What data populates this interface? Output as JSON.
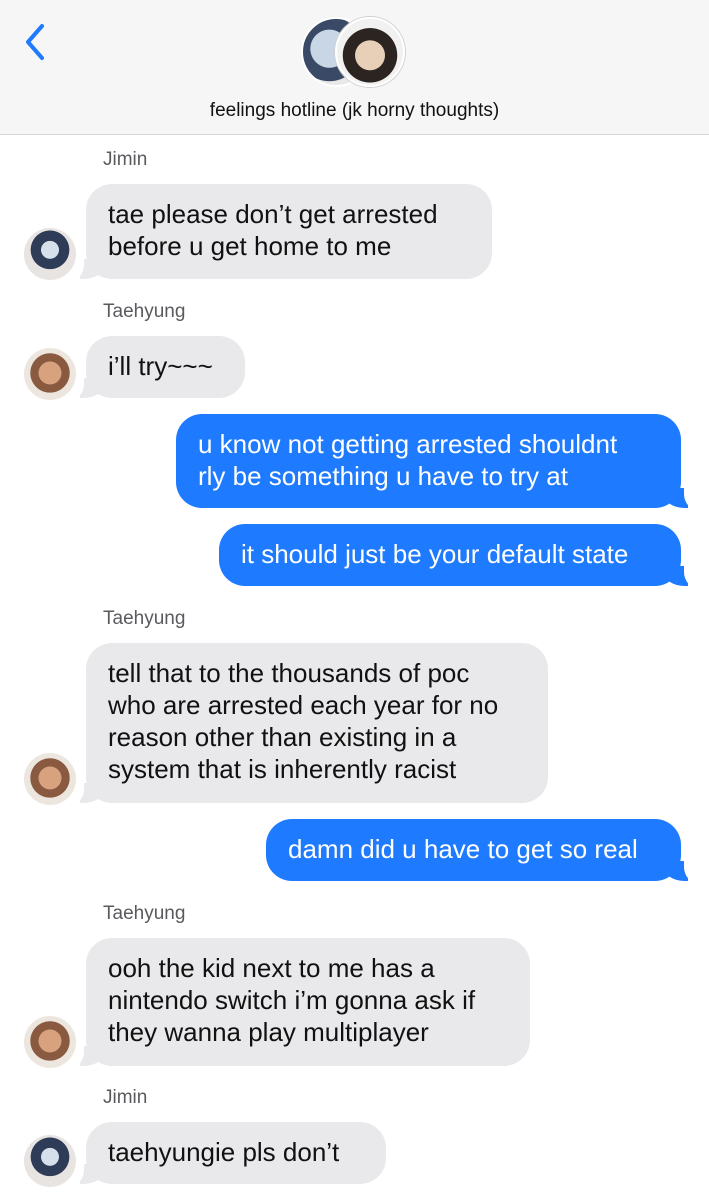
{
  "header": {
    "back_icon": "chevron-left-icon",
    "accent_color": "#1e7bff",
    "title": "feelings hotline (jk horny thoughts)"
  },
  "messages": [
    {
      "sender": "Jimin",
      "direction": "incoming",
      "lines": [
        "tae please don’t get arrested",
        "before u get home to me"
      ]
    },
    {
      "sender": "Taehyung",
      "direction": "incoming",
      "lines": [
        "i’ll try~~~"
      ]
    },
    {
      "sender": "",
      "direction": "outgoing",
      "lines": [
        "u know not getting arrested shouldnt",
        "rly be something u have to try at"
      ]
    },
    {
      "sender": "",
      "direction": "outgoing",
      "lines": [
        "it should just be your default state"
      ]
    },
    {
      "sender": "Taehyung",
      "direction": "incoming",
      "lines": [
        "tell that to the thousands of poc",
        "who are arrested each year for no",
        "reason other than existing in a",
        "system that is inherently racist"
      ]
    },
    {
      "sender": "",
      "direction": "outgoing",
      "lines": [
        "damn did u have to get so real"
      ]
    },
    {
      "sender": "Taehyung",
      "direction": "incoming",
      "lines": [
        "ooh the kid next to me has a",
        "nintendo switch i’m gonna ask if",
        "they wanna play multiplayer"
      ]
    },
    {
      "sender": "Jimin",
      "direction": "incoming",
      "lines": [
        "taehyungie pls don’t"
      ]
    }
  ],
  "colors": {
    "incoming_bubble": "#e9e9eb",
    "outgoing_bubble": "#1e7bff",
    "sender_label": "#5a5a5e"
  }
}
